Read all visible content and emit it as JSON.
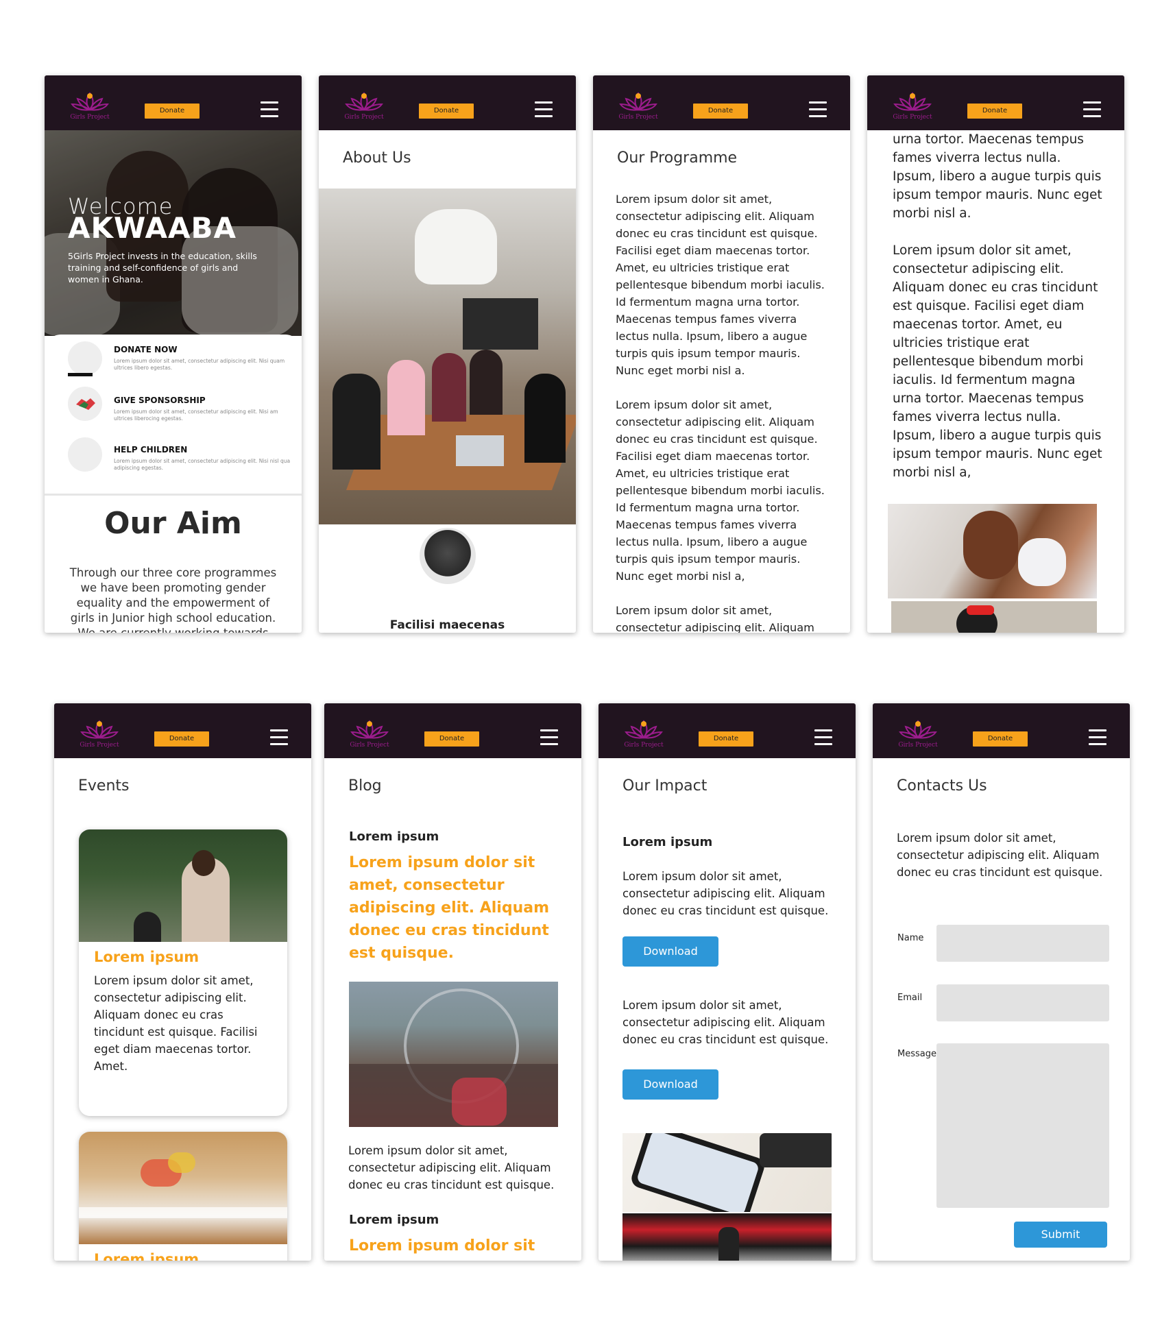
{
  "common": {
    "logo_text": "Girls Project",
    "donate_label": "Donate",
    "brand_colors": {
      "header": "#21141f",
      "accent": "#f7a21b",
      "logo": "#9b1c8c",
      "button_blue": "#2d97d8"
    }
  },
  "home": {
    "welcome": "Welcome",
    "akwaaba": "AKWAABA",
    "hero_desc": "5Girls Project invests in the education, skills training and self-confidence of girls and women in Ghana.",
    "services": [
      {
        "title": "DONATE NOW",
        "desc": "Lorem ipsum dolor sit amet, consectetur adipiscing elit. Nisi quam ultrices libero egestas.",
        "icon": "donate-icon"
      },
      {
        "title": "GIVE SPONSORSHIP",
        "desc": "Lorem ipsum dolor sit amet, consectetur adipiscing elit. Nisi am ultrices liberocing egestas.",
        "icon": "handshake-icon"
      },
      {
        "title": "HELP CHILDREN",
        "desc": "Lorem ipsum dolor sit amet, consectetur adipiscing elit. Nisi nisl qua adipiscing egestas.",
        "icon": "children-icon"
      }
    ],
    "aim_title": "Our Aim",
    "aim_text": "Through our three core programmes we have been promoting gender equality and the empowerment of girls in Junior high school education. We are currently working towards"
  },
  "about": {
    "title": "About Us",
    "member_name": "Facilisi maecenas"
  },
  "programme": {
    "title": "Our Programme",
    "paragraphs": [
      "Lorem ipsum dolor sit amet, consectetur adipiscing elit. Aliquam donec eu cras tincidunt est quisque. Facilisi eget diam maecenas tortor. Amet, eu ultricies tristique erat pellentesque bibendum morbi iaculis. Id fermentum magna urna tortor. Maecenas tempus fames viverra lectus nulla. Ipsum, libero a augue turpis quis ipsum tempor mauris. Nunc eget morbi nisl a.",
      "Lorem ipsum dolor sit amet, consectetur adipiscing elit. Aliquam donec eu cras tincidunt est quisque. Facilisi eget diam maecenas tortor. Amet, eu ultricies tristique erat pellentesque bibendum morbi iaculis. Id fermentum magna urna tortor. Maecenas tempus fames viverra lectus nulla. Ipsum, libero a augue turpis quis ipsum tempor mauris. Nunc eget morbi nisl a,",
      "Lorem ipsum dolor sit amet, consectetur adipiscing elit. Aliquam"
    ]
  },
  "programme2": {
    "paragraphs": [
      "urna tortor. Maecenas tempus fames viverra lectus nulla. Ipsum, libero a augue turpis quis ipsum tempor mauris. Nunc eget morbi nisl a.",
      "Lorem ipsum dolor sit amet, consectetur adipiscing elit. Aliquam donec eu cras tincidunt est quisque. Facilisi eget diam maecenas tortor. Amet, eu ultricies tristique erat pellentesque bibendum morbi iaculis. Id fermentum magna urna tortor. Maecenas tempus fames viverra lectus nulla. Ipsum, libero a augue turpis quis ipsum tempor mauris. Nunc eget morbi nisl a,"
    ]
  },
  "events": {
    "title": "Events",
    "cards": [
      {
        "heading": "Lorem ipsum",
        "text": "Lorem ipsum dolor sit amet, consectetur adipiscing elit. Aliquam donec eu cras tincidunt est quisque. Facilisi eget diam maecenas tortor. Amet."
      },
      {
        "heading": "Lorem ipsum"
      }
    ]
  },
  "blog": {
    "title": "Blog",
    "subheading": "Lorem ipsum",
    "headline": "Lorem ipsum dolor sit amet, consectetur adipiscing elit. Aliquam donec eu cras tincidunt est quisque.",
    "body": "Lorem ipsum dolor sit amet, consectetur adipiscing elit. Aliquam donec eu cras tincidunt est quisque.",
    "subheading2": "Lorem ipsum",
    "headline2": "Lorem ipsum dolor sit"
  },
  "impact": {
    "title": "Our Impact",
    "subheading": "Lorem ipsum",
    "text1": "Lorem ipsum dolor sit amet, consectetur adipiscing elit. Aliquam donec eu cras tincidunt est quisque.",
    "download1": "Download",
    "text2": "Lorem ipsum dolor sit amet, consectetur adipiscing elit. Aliquam donec eu cras tincidunt est quisque.",
    "download2": "Download"
  },
  "contact": {
    "title": "Contacts Us",
    "intro": "Lorem ipsum dolor sit amet, consectetur adipiscing elit. Aliquam donec eu cras tincidunt est quisque.",
    "name_label": "Name",
    "email_label": "Email",
    "message_label": "Message",
    "submit_label": "Submit"
  }
}
